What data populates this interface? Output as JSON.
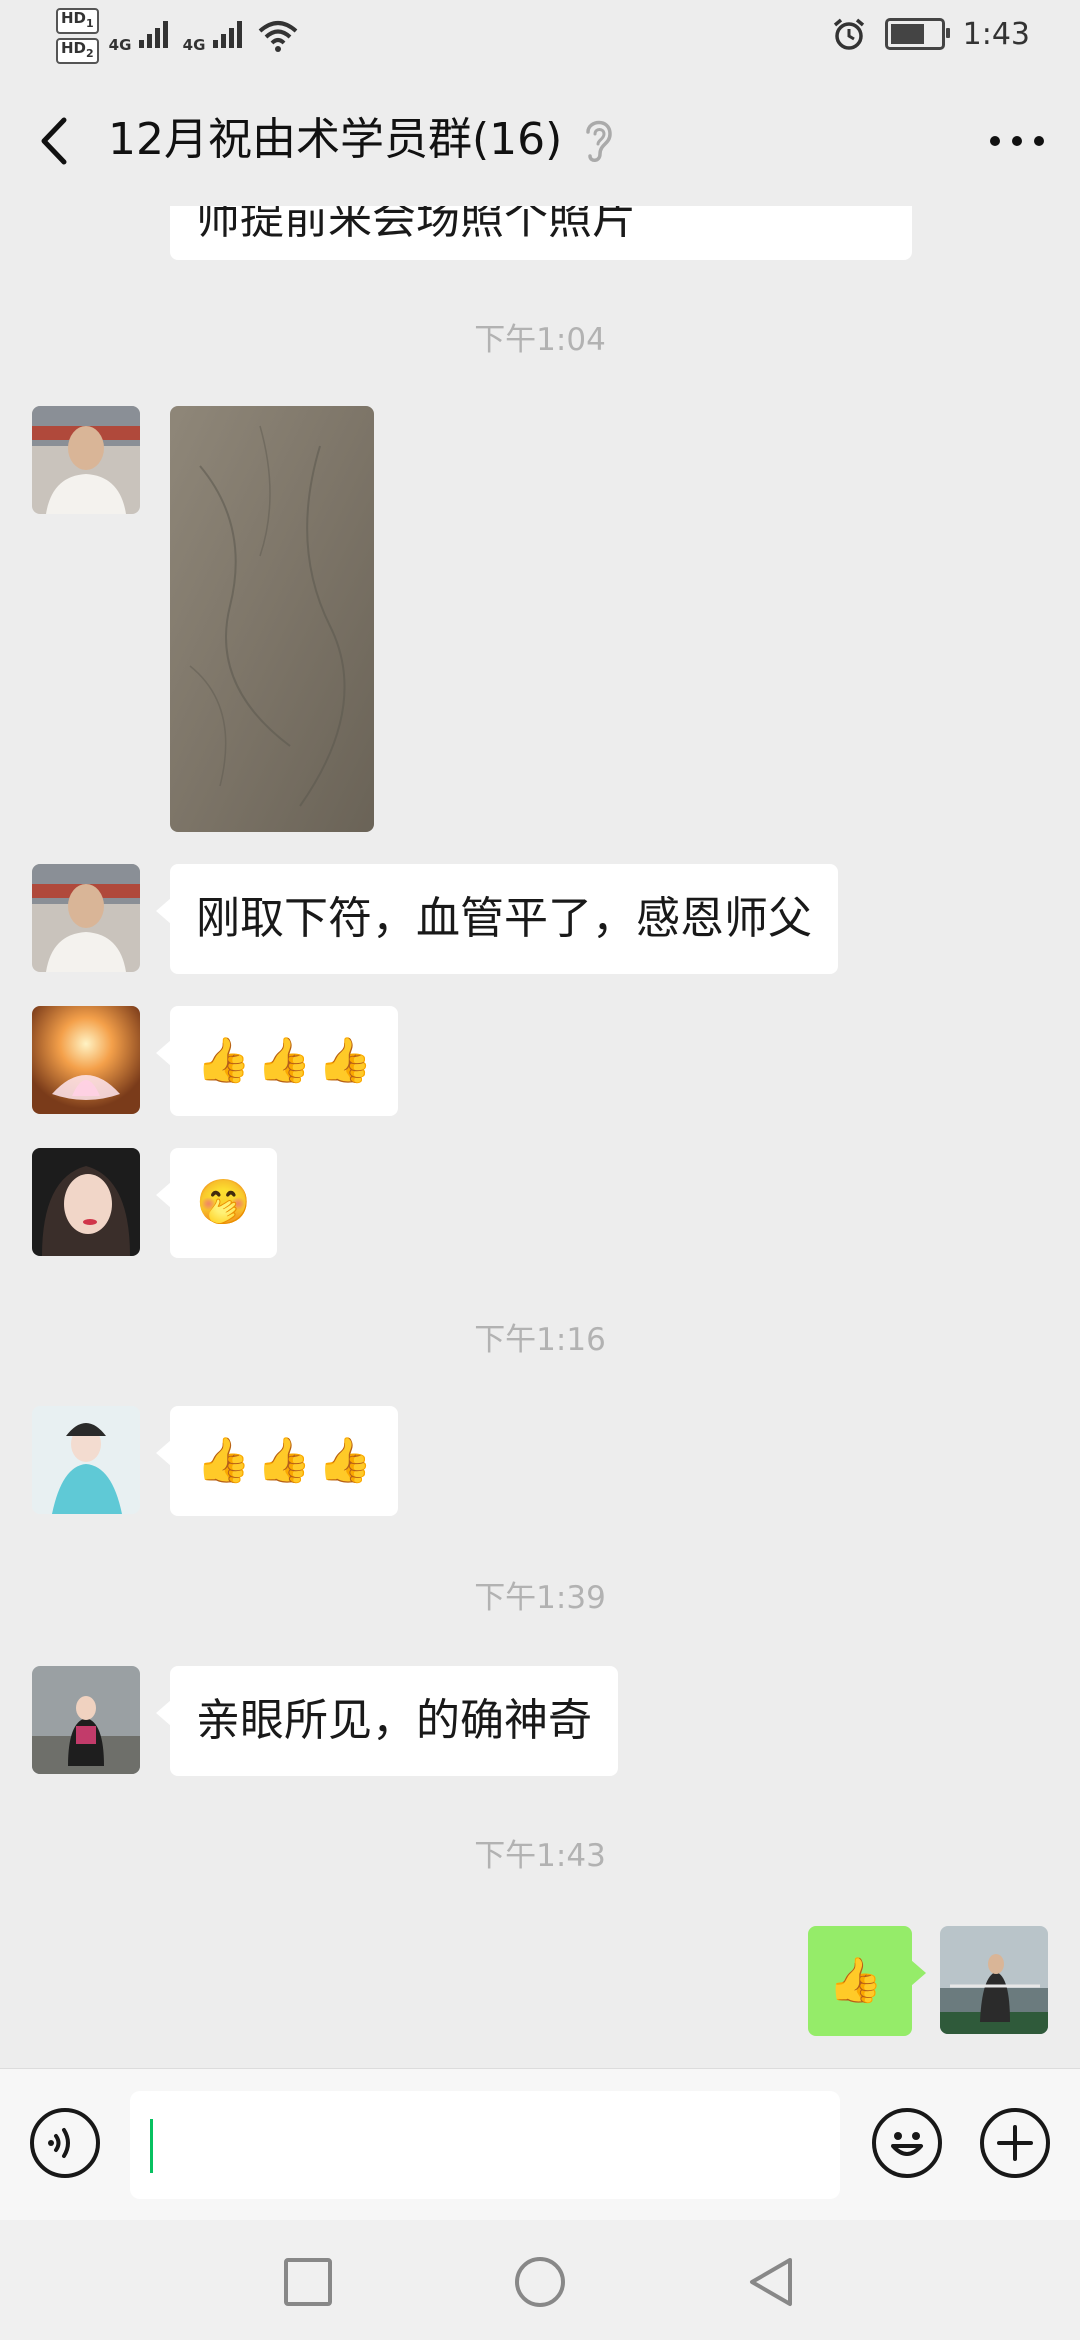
{
  "status_bar": {
    "hd1": "HD",
    "hd1_sub": "1",
    "hd2": "HD",
    "hd2_sub": "2",
    "network1": "4G",
    "network2": "4G",
    "time": "1:43",
    "battery_level": 0.8
  },
  "header": {
    "title": "12月祝由术学员群(16)",
    "back_icon": "chevron-left-icon",
    "mute_icon": "ear-icon",
    "more_icon": "more-dots-icon"
  },
  "messages": {
    "partial_top": "师提前来会场照个照片",
    "ts1": "下午1:04",
    "msg2": "刚取下符，血管平了，感恩师父",
    "msg3_emoji": [
      "👍",
      "👍",
      "👍"
    ],
    "msg4_emoji": "🤭",
    "ts2": "下午1:16",
    "msg5_emoji": [
      "👍",
      "👍",
      "👍"
    ],
    "ts3": "下午1:39",
    "msg6": "亲眼所见，的确神奇",
    "ts4": "下午1:43",
    "msg7_emoji": "👍"
  },
  "input_bar": {
    "voice_icon": "voice-icon",
    "emoji_icon": "smiley-icon",
    "plus_icon": "plus-icon",
    "value": ""
  },
  "colors": {
    "background": "#ededed",
    "incoming_bubble": "#ffffff",
    "outgoing_bubble": "#95ec69",
    "timestamp": "#b2b2b2",
    "caret": "#07c160"
  }
}
